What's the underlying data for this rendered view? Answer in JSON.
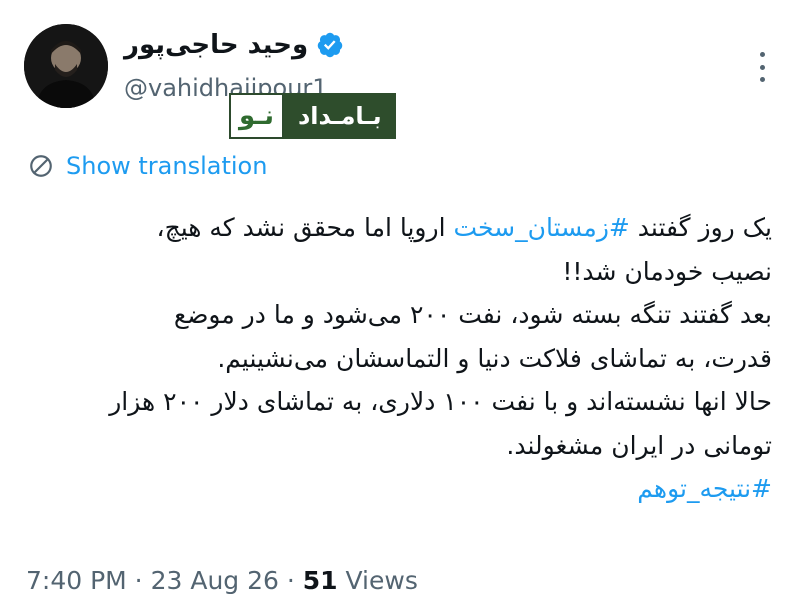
{
  "author": {
    "display_name": "وحید حاجی‌پور",
    "handle": "@vahidhajipour1",
    "verified": true,
    "verified_color": "#1d9bf0"
  },
  "watermark": {
    "part_dark": "بـامـداد",
    "part_light": "نـو"
  },
  "translate": {
    "label": "Show translation"
  },
  "tweet": {
    "line1_a": "یک روز گفتند ",
    "line1_tag": "#زمستان_سخت",
    "line1_b": " اروپا اما محقق نشد که هیچ،",
    "line2": "نصیب خودمان شد!!",
    "line3": "بعد گفتند تنگه بسته شود، نفت ۲۰۰ می‌شود و ما در موضع",
    "line4": "قدرت، به تماشای فلاکت دنیا و التماسشان می‌نشینیم.",
    "line5": "حالا انها نشسته‌اند و با نفت ۱۰۰ دلاری، به تماشای دلار ۲۰۰ هزار",
    "line6": "تومانی در ایران مشغولند.",
    "tag2": "#نتیجه_توهم"
  },
  "meta": {
    "time": "7:40 PM",
    "sep": " · ",
    "date": "23 Aug 26",
    "views_count": "51",
    "views_label": " Views"
  },
  "colors": {
    "link": "#1d9bf0",
    "secondary": "#536471",
    "text": "#0f1419"
  }
}
